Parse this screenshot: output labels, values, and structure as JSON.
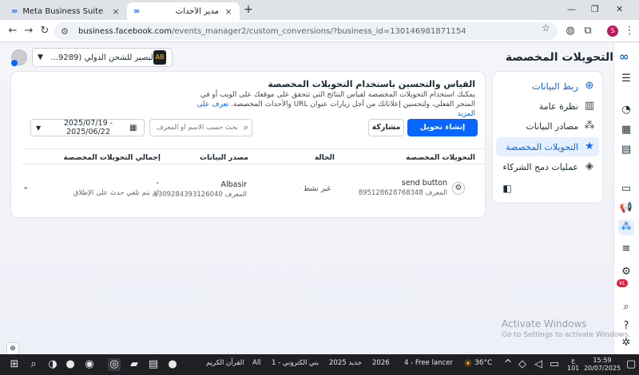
{
  "browser": {
    "tabs": [
      {
        "title": "Meta Business Suite",
        "active": false
      },
      {
        "title": "مدير الأحداث",
        "active": true
      }
    ],
    "url_host": "business.facebook.com",
    "url_path": "/events_manager2/custom_conversions/?business_id=130146981871154",
    "profile_initial": "S"
  },
  "header": {
    "page_title": "التحويلات المخصصة",
    "account_label": "البصير للشحن الدولي (9289...",
    "account_thumb": "AB"
  },
  "sidebar": {
    "items": [
      {
        "label": "ربط البيانات",
        "icon": "plus-circle-icon",
        "type": "link"
      },
      {
        "label": "نظرة عامة",
        "icon": "overview-icon",
        "type": "normal"
      },
      {
        "label": "مصادر البيانات",
        "icon": "data-sources-icon",
        "type": "normal"
      },
      {
        "label": "التحويلات المخصصة",
        "icon": "custom-conversions-icon",
        "type": "active"
      },
      {
        "label": "عمليات دمج الشركاء",
        "icon": "handshake-icon",
        "type": "normal"
      }
    ],
    "collapse_icon": "collapse-panel-icon"
  },
  "card": {
    "title": "القياس والتحسين باستخدام التحويلات المخصصة",
    "description": "يمكنك استخدام التحويلات المخصصة لقياس النتائج التي تتحقق على موقعك على الويب أو في المتجر الفعلي، ولتحسين إعلاناتك من أجل زيارات عنوان URL والأحداث المخصصة.",
    "learn_more": "تعرف على المزيد",
    "create_button": "إنشاء تحويل مخصص",
    "share_button": "مشاركة",
    "search_placeholder": "بحث حسب الاسم أو المعرف",
    "date_range": "2025/07/19 - 2025/06/22"
  },
  "table": {
    "columns": [
      "التحويلات المخصصة",
      "الحالة",
      "مصدر البيانات",
      "إجمالي التحويلات المخصصة"
    ],
    "rows": [
      {
        "name": "send button",
        "id_label": "المعرف 895128628768348",
        "status": "غير نشط",
        "source_name": "Albasir",
        "source_id": "المعرف 1309284393126040",
        "total": "-",
        "total_note": "لم يتم تلقي حدث على الإطلاق"
      }
    ]
  },
  "watermark": {
    "line1": "Activate Windows",
    "line2": "Go to Settings to activate Windows."
  },
  "taskbar": {
    "apps": [
      {
        "label": "القرآن الكريم"
      },
      {
        "label": "All"
      },
      {
        "label": "1 - بني الكتروني"
      },
      {
        "label": "جديد 2025"
      },
      {
        "label": "2026"
      },
      {
        "label": "4 - Free lancer"
      }
    ],
    "weather": "36°C",
    "lang": "ع",
    "lang_sub": "101",
    "time": "15:59",
    "date": "20/07/2025"
  },
  "colors": {
    "brand": "#0866ff",
    "active_bg": "#e7f0ff"
  }
}
